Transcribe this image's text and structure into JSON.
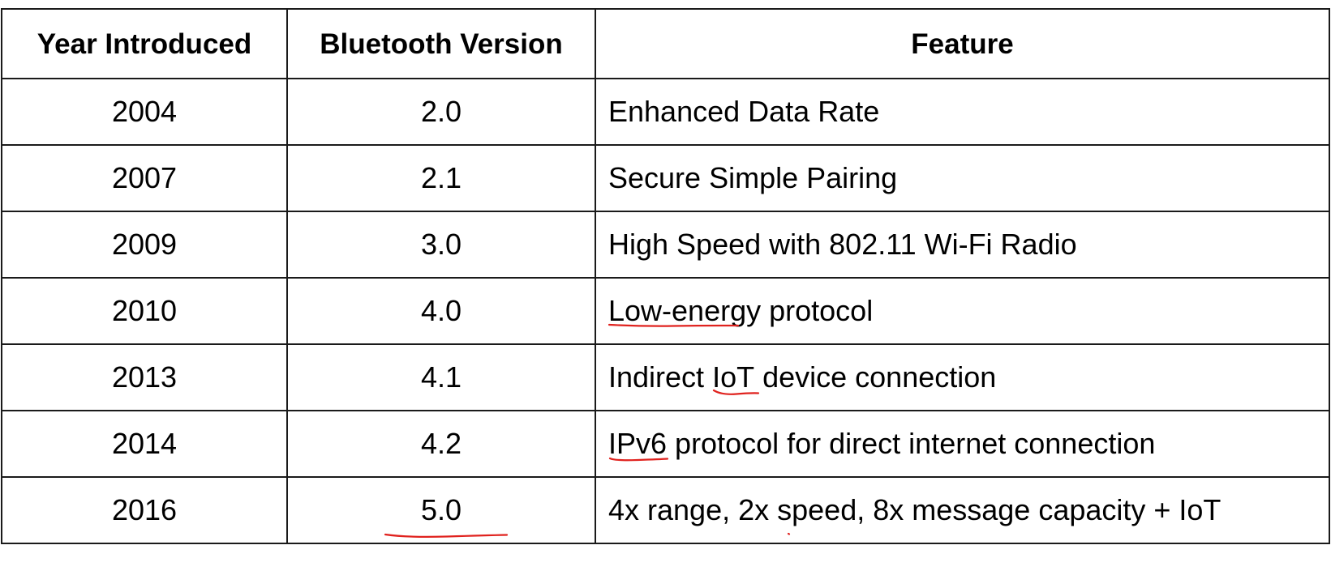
{
  "table": {
    "headers": [
      "Year Introduced",
      "Bluetooth Version",
      "Feature"
    ],
    "rows": [
      {
        "year": "2004",
        "version": "2.0",
        "feature": "Enhanced Data Rate"
      },
      {
        "year": "2007",
        "version": "2.1",
        "feature": "Secure Simple Pairing"
      },
      {
        "year": "2009",
        "version": "3.0",
        "feature": "High Speed with 802.11 Wi-Fi Radio"
      },
      {
        "year": "2010",
        "version": "4.0",
        "feature_parts": [
          "Low-energy",
          " protocol"
        ]
      },
      {
        "year": "2013",
        "version": "4.1",
        "feature_parts": [
          "Indirect ",
          "IoT",
          " device connection"
        ]
      },
      {
        "year": "2014",
        "version": "4.2",
        "feature_parts": [
          "IPv6",
          " protocol for direct internet connection"
        ]
      },
      {
        "year": "2016",
        "version": "5.0",
        "feature": "4x range, 2x speed, 8x message capacity + IoT"
      }
    ]
  },
  "annotations": {
    "ink_color": "#e0221e",
    "underlined_terms": [
      "Low-energy",
      "IoT",
      "IPv6",
      "5.0"
    ]
  }
}
